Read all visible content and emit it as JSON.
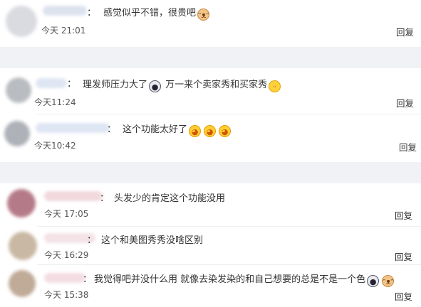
{
  "comments": [
    {
      "text": "感觉似乎不错，很贵吧",
      "emoji": [
        "cat-emoji"
      ],
      "time": "今天 21:01",
      "reply": "回复"
    },
    {
      "text": "理发师压力大了",
      "emoji_mid": [
        "panda-emoji"
      ],
      "text2": "万一来个卖家秀和买家秀",
      "emoji": [
        "yum-emoji"
      ],
      "time": "今天11:24",
      "reply": "回复"
    },
    {
      "text": "这个功能太好了",
      "emoji": [
        "shy-emoji",
        "shy-emoji",
        "shy-emoji"
      ],
      "time": "今天10:42",
      "reply": "回复"
    },
    {
      "text": "头发少的肯定这个功能没用",
      "time": "今天 17:05",
      "reply": "回复"
    },
    {
      "text": "这个和美图秀秀没啥区别",
      "time": "今天 16:29",
      "reply": "回复"
    },
    {
      "text": "我觉得吧并没什么用 就像去染发染的和自己想要的总是不是一个色",
      "emoji": [
        "panda-emoji",
        "cat-emoji"
      ],
      "time": "今天 15:38",
      "reply": "回复"
    }
  ],
  "colon": "："
}
